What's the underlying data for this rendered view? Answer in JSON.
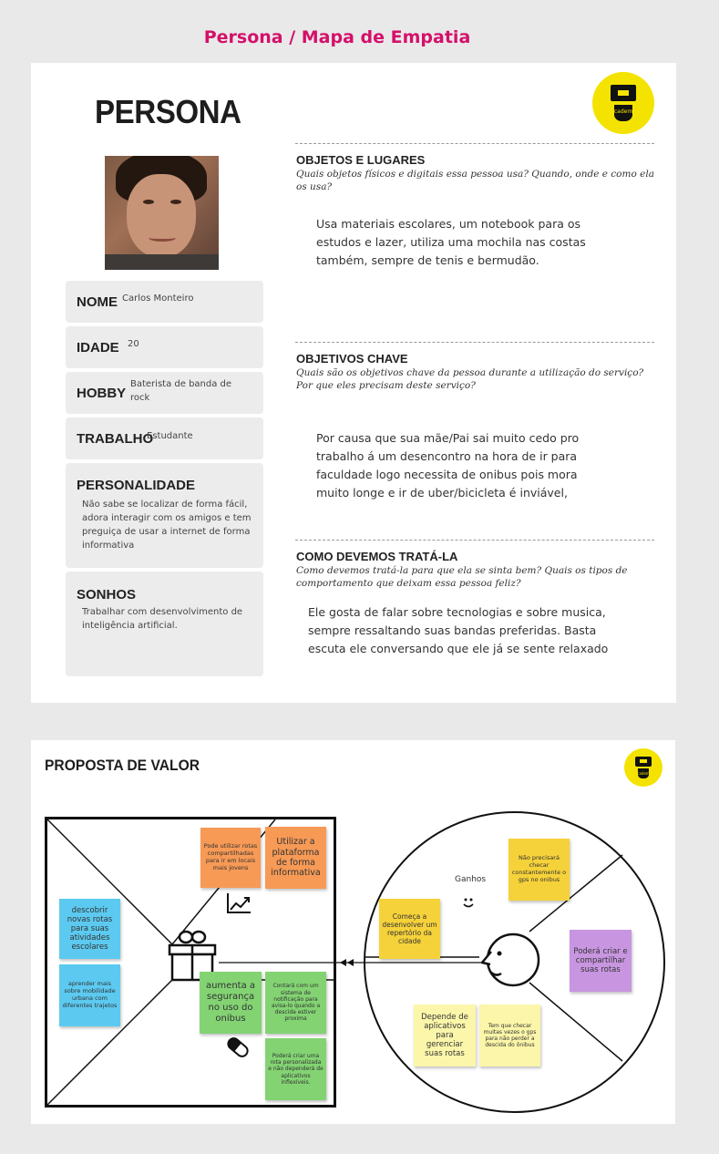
{
  "page_title": "Persona / Mapa de Empatia",
  "persona": {
    "title": "PERSONA",
    "logo_word": "academy",
    "nome_label": "NOME",
    "nome_value": "Carlos Monteiro",
    "idade_label": "IDADE",
    "idade_value": "20",
    "hobby_label": "HOBBY",
    "hobby_value": "Baterista de banda de rock",
    "trabalho_label": "TRABALHO",
    "trabalho_value": "Estudante",
    "personalidade_label": "PERSONALIDADE",
    "personalidade_value": "Não sabe se localizar de forma fácil, adora interagir com os amigos e tem preguiça de usar a internet de forma informativa",
    "sonhos_label": "SONHOS",
    "sonhos_value": "Trabalhar com desenvolvimento de inteligência artificial."
  },
  "sections": {
    "objetos_title": "OBJETOS E LUGARES",
    "objetos_q": "Quais objetos físicos e digitais essa pessoa usa? Quando, onde e como ela os usa?",
    "objetos_body": "Usa materiais escolares, um notebook para os estudos e lazer, utiliza uma mochila nas costas também, sempre de tenis e bermudão.",
    "objetivos_title": "OBJETIVOS CHAVE",
    "objetivos_q": "Quais são os objetivos chave da pessoa durante a utilização do serviço? Por que eles precisam deste serviço?",
    "objetivos_body": "Por causa que sua mãe/Pai sai muito cedo pro trabalho á um desencontro na hora de ir para faculdade logo necessita de onibus pois mora muito longe e ir de uber/bicicleta é inviável,",
    "tratar_title": "COMO DEVEMOS TRATÁ-LA",
    "tratar_q": "Como devemos tratá-la para que ela se sinta bem? Quais os tipos de comportamento que deixam essa pessoa feliz?",
    "tratar_body": "Ele gosta de falar sobre tecnologias e sobre musica, sempre ressaltando suas bandas preferidas. Basta escuta ele conversando que ele já se sente relaxado"
  },
  "value_proposition": {
    "title": "PROPOSTA DE VALOR",
    "ganhos_label": "Ganhos",
    "notes": {
      "orange_1": "Pode utilizar rotas compartilhadas para ir em locais mais jovens",
      "orange_2": "Utilizar a plataforma de forma informativa",
      "blue_1": "descobrir novas rotas para suas atividades escolares",
      "blue_2": "aprender mais sobre mobilidade urbana com diferentes trajetos",
      "green_1": "aumenta a segurança no uso do onibus",
      "green_2": "Contará com um sistema de notificação para avisa-lo quando a descida estiver proxima",
      "green_3": "Poderá criar uma rota personalizada e não dependerá de aplicativos inflexíveis.",
      "yellow_1": "Não precisará checar constantemente o gps no onibus",
      "yellow_2": "Começa a desenvolver um repertório da cidade",
      "purple_1": "Poderá criar e compartilhar suas rotas",
      "pale_1": "Depende de aplicativos para gerenciar suas rotas",
      "pale_2": "Tem que checar muitas vezes o gps para não perder a descida do ônibus"
    }
  },
  "colors": {
    "heading": "#d4106a",
    "logo": "#f4e300"
  }
}
